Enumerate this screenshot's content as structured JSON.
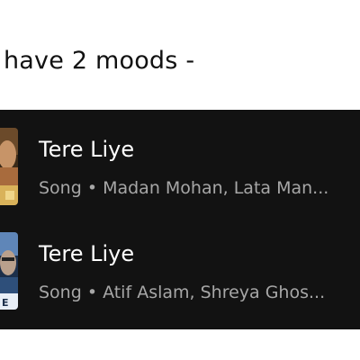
{
  "caption": "have 2 moods -",
  "songs": [
    {
      "title": "Tere Liye",
      "subtitle": "Song • Madan Mohan, Lata Man...",
      "thumbnail_icon": "album-cover-retro"
    },
    {
      "title": "Tere Liye",
      "subtitle": "Song • Atif Aslam, Shreya Ghos...",
      "thumbnail_icon": "album-cover-modern"
    }
  ],
  "colors": {
    "panel_background": "#121212",
    "title_text": "#ffffff",
    "subtitle_text": "#a7a7a7"
  }
}
